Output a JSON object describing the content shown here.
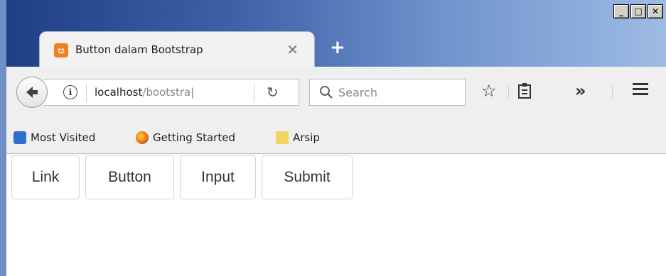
{
  "window": {
    "controls": [
      "_",
      "□",
      "✕"
    ]
  },
  "tab": {
    "title": "Button dalam Bootstrap",
    "close": "✕",
    "new_tab": "+"
  },
  "navbar": {
    "url_host": "localhost",
    "url_path": "/bootstra|",
    "search_placeholder": "Search",
    "overflow": "»"
  },
  "bookmarks": [
    {
      "label": "Most Visited",
      "icon": "most-visited-icon"
    },
    {
      "label": "Getting Started",
      "icon": "firefox-icon"
    },
    {
      "label": "Arsip",
      "icon": "folder-icon"
    }
  ],
  "buttons": [
    {
      "label": "Link",
      "type": "link"
    },
    {
      "label": "Button",
      "type": "button"
    },
    {
      "label": "Input",
      "type": "input"
    },
    {
      "label": "Submit",
      "type": "submit"
    }
  ],
  "colors": {
    "title_gradient_start": "#1f3f86",
    "title_gradient_end": "#9ebbe4",
    "favicon": "#f07f1e"
  }
}
